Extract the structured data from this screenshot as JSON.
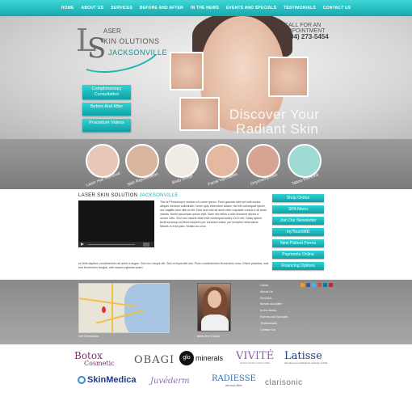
{
  "nav": {
    "items": [
      "HOME",
      "ABOUT US",
      "SERVICES",
      "BEFORE AND AFTER",
      "IN THE NEWS",
      "EVENTS AND SPECIALS",
      "TESTIMONIALS",
      "CONTACT US"
    ]
  },
  "logo": {
    "line1": "ASER",
    "line2": "KIN OLUTIONS",
    "line3": "JACKSONVILLE"
  },
  "header": {
    "call_label": "CALL FOR AN APPOINTMENT",
    "phone": "(904) 273-5454",
    "tagline1": "Discover Your",
    "tagline2": "Radiant Skin"
  },
  "hero_buttons": [
    "Complimentary Consultation",
    "Before And After",
    "Procedure Videos"
  ],
  "treatments": [
    {
      "label": "Laser Hair Removal",
      "color": "#e7c8b8"
    },
    {
      "label": "Skin Rejuvenation",
      "color": "#d9b49f"
    },
    {
      "label": "Body Sculpt",
      "color": "#f1ebe6"
    },
    {
      "label": "Facial Injectables",
      "color": "#e5b8a2"
    },
    {
      "label": "Onychomycosis",
      "color": "#d6a492"
    },
    {
      "label": "Tattoo Removal",
      "color": "#9fdad5"
    }
  ],
  "main": {
    "title_prefix": "LASER SKIN SOLUTION",
    "title_accent": "JACKSONVILLE",
    "paragraph1": "This is Photoshop's version of Lorem Ipsum. Proin gravida nibh vel velit auctor aliquet. Aenean sollicitudin, lorem quis bibendum auctor, nisi elit consequat ipsum, nec sagittis sem nibh id elit. Duis sed odio sit amet nibh vulputate cursus a sit amet mauris. Morbi accumsan ipsum velit. Nam nec tellus a odio tincidunt auctor a ornare odio. Sed non mauris vitae erat consequat auctor eu in elit. Class aptent taciti sociosqu ad litora torquent per conubia nostra, per inceptos himenaeos. Mauris in erat justo. Nullam ac urna",
    "paragraph2": "eu felis dapibus condimentum sit amet a augue. Sed non neque elit. Sed ut imperdiet nisi. Proin condimentum fermentum nunc. Etiam pharetra, erat sed fermentum feugiat, velit mauris egestas quam."
  },
  "side_buttons": [
    "Shop Online",
    "SPA Menu",
    "Join Our Newsletter",
    "myTouchMD",
    "New Patient Forms",
    "Payments Online",
    "Financing Options"
  ],
  "footer": {
    "directions_caption": "Get Directions",
    "doctor_caption": "Meet the Doctor",
    "links": [
      "Home",
      "About Us",
      "Services",
      "Before and After",
      "In the News",
      "Events and Specials",
      "Testimonials",
      "Contact Us"
    ],
    "social_colors": [
      "#f29a2e",
      "#3b5998",
      "#55acee",
      "#d84b37",
      "#0e76a8",
      "#cc2127"
    ]
  },
  "brands": [
    {
      "name": "BOTOX Cosmetic",
      "text1": "Botox",
      "text2": "Cosmetic",
      "color": "#7c2e6b"
    },
    {
      "name": "OBAGI",
      "text1": "OBAGI",
      "color": "#555555"
    },
    {
      "name": "Glo Minerals",
      "text1": "glo",
      "text2": "minerals",
      "color": "#111111"
    },
    {
      "name": "Vivite",
      "text1": "VIVITÉ",
      "text2": "EXFOLIATING SKIN CARE",
      "color": "#8a63a8"
    },
    {
      "name": "Latisse",
      "text1": "Latisse",
      "text2": "(bimatoprost ophthalmic solution) 0.03%",
      "color": "#1c3f82"
    },
    {
      "name": "SkinMedica",
      "text1": "SkinMedica",
      "color": "#1e3e8a"
    },
    {
      "name": "Juvederm",
      "text1": "Juvéderm",
      "color": "#8f6bb4"
    },
    {
      "name": "Radiesse",
      "text1": "RADIESSE",
      "text2": "dermal filler",
      "color": "#2a6fb4"
    },
    {
      "name": "Clarisonic",
      "text1": "clarisonic",
      "color": "#777777"
    }
  ]
}
